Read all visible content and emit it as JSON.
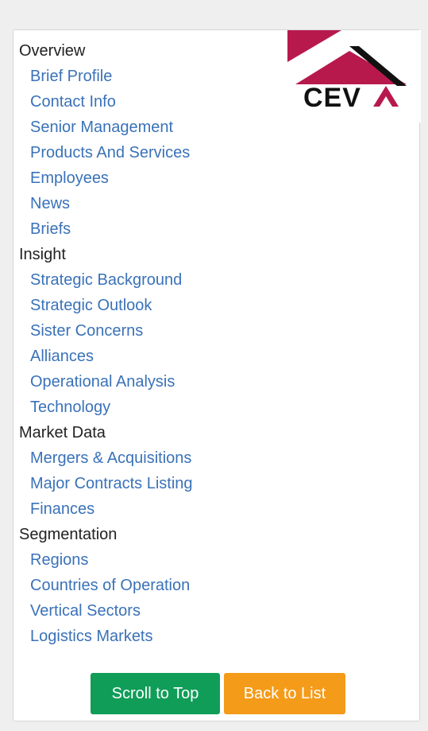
{
  "nav": {
    "sections": [
      {
        "title": "Overview",
        "items": [
          "Brief Profile",
          "Contact Info",
          "Senior Management",
          "Products And Services",
          "Employees",
          "News",
          "Briefs"
        ]
      },
      {
        "title": "Insight",
        "items": [
          "Strategic Background",
          "Strategic Outlook",
          "Sister Concerns",
          "Alliances",
          "Operational Analysis",
          "Technology"
        ]
      },
      {
        "title": "Market Data",
        "items": [
          "Mergers & Acquisitions",
          "Major Contracts Listing",
          "Finances"
        ]
      },
      {
        "title": "Segmentation",
        "items": [
          "Regions",
          "Countries of Operation",
          "Vertical Sectors",
          "Logistics Markets"
        ]
      }
    ]
  },
  "logo": {
    "text": "CEVA",
    "colors": {
      "brand": "#b8194d",
      "mark": "#111111"
    }
  },
  "buttons": {
    "scroll_top": "Scroll to Top",
    "back_to_list": "Back to List"
  },
  "colors": {
    "link": "#3a72b8",
    "heading": "#222222",
    "scroll_top_bg": "#0f9d58",
    "back_to_list_bg": "#f49b19"
  }
}
